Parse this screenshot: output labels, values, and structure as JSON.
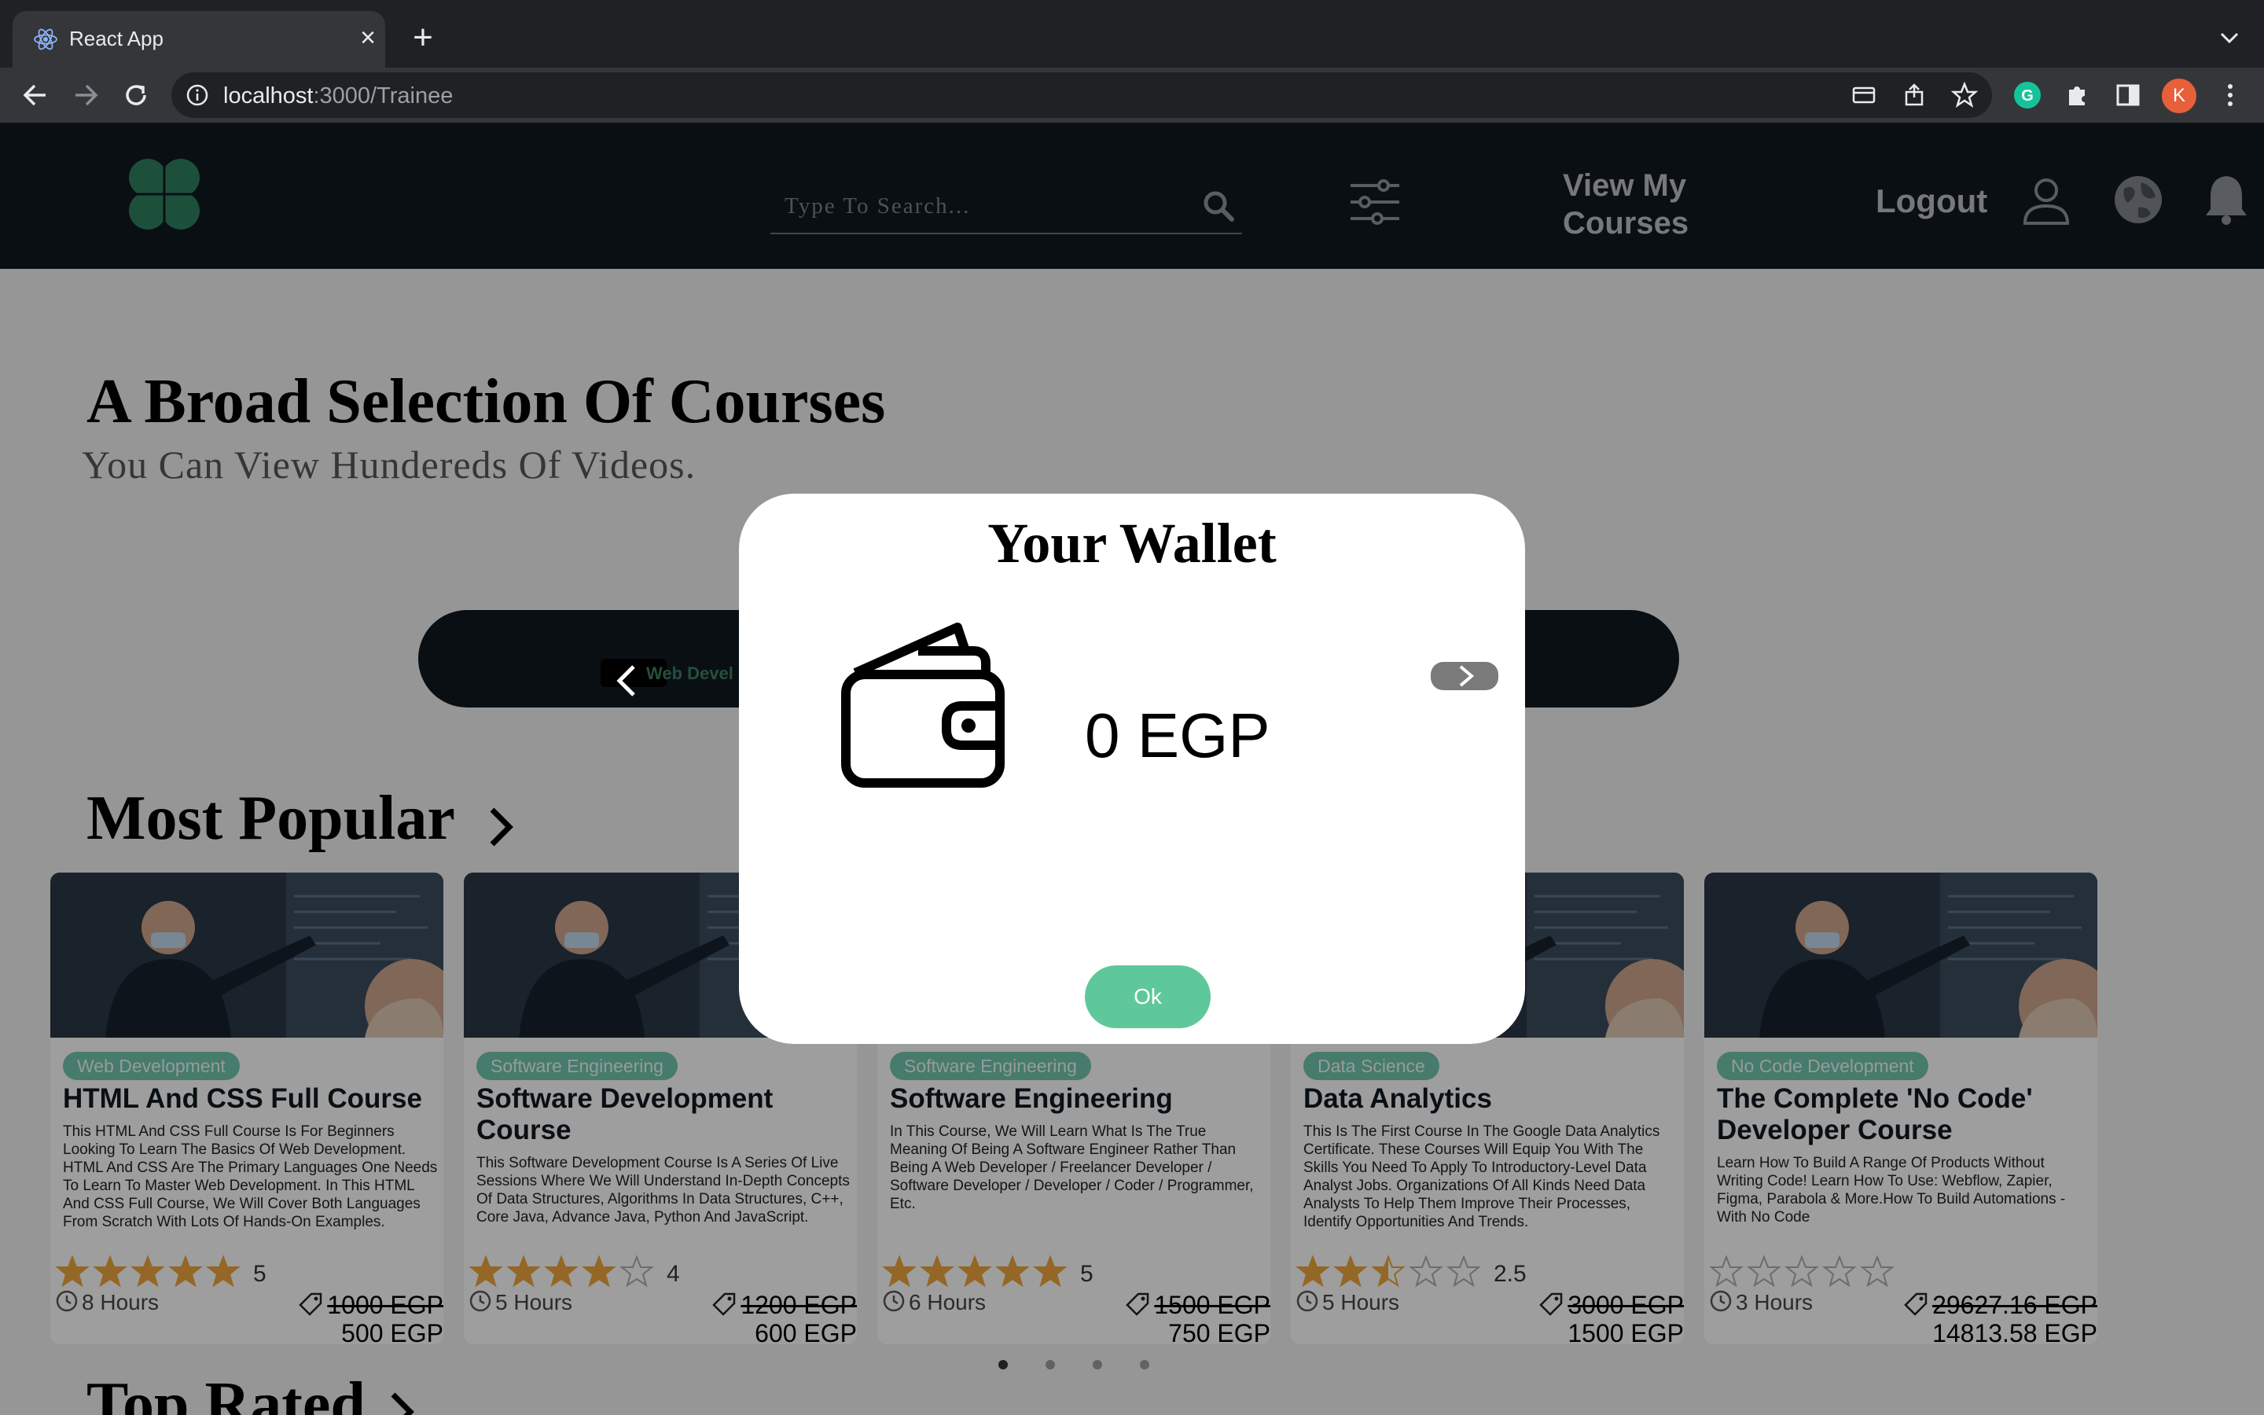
{
  "browser": {
    "tab_title": "React App",
    "url_host": "localhost",
    "url_path": ":3000/Trainee",
    "profile_initial": "K"
  },
  "header": {
    "search_placeholder": "Type To Search...",
    "view_courses": "View My Courses",
    "logout": "Logout"
  },
  "hero": {
    "title": "A Broad Selection Of Courses",
    "subtitle": "You Can View Hundereds Of Videos."
  },
  "category_bar": {
    "visible_chip": "Web Devel"
  },
  "sections": {
    "most_popular": "Most Popular",
    "top_rated": "Top Rated"
  },
  "courses": [
    {
      "category": "Web Development",
      "title": "HTML And CSS Full Course",
      "description": "This HTML And CSS Full Course Is For Beginners Looking To Learn The Basics Of Web Development. HTML And CSS Are The Primary Languages One Needs To Learn To Master Web Development. In This HTML And CSS Full Course, We Will Cover Both Languages From Scratch With Lots Of Hands-On Examples.",
      "rating": 5,
      "rating_label": "5",
      "hours": "8 Hours",
      "old_price": "1000 EGP",
      "price": "500 EGP"
    },
    {
      "category": "Software Engineering",
      "title": "Software Development Course",
      "description": "This Software Development Course Is A Series Of Live Sessions Where We Will Understand In-Depth Concepts Of Data Structures, Algorithms In Data Structures, C++, Core Java, Advance Java, Python And JavaScript.",
      "rating": 4,
      "rating_label": "4",
      "hours": "5 Hours",
      "old_price": "1200 EGP",
      "price": "600 EGP"
    },
    {
      "category": "Software Engineering",
      "title": "Software Engineering",
      "description": "In This Course, We Will Learn What Is The True Meaning Of Being A Software Engineer Rather Than Being A Web Developer / Freelancer Developer / Software Developer / Developer / Coder / Programmer, Etc.",
      "rating": 5,
      "rating_label": "5",
      "hours": "6 Hours",
      "old_price": "1500 EGP",
      "price": "750 EGP"
    },
    {
      "category": "Data Science",
      "title": "Data Analytics",
      "description": "This Is The First Course In The Google Data Analytics Certificate. These Courses Will Equip You With The Skills You Need To Apply To Introductory-Level Data Analyst Jobs. Organizations Of All Kinds Need Data Analysts To Help Them Improve Their Processes, Identify Opportunities And Trends.",
      "rating": 2.5,
      "rating_label": "2.5",
      "hours": "5 Hours",
      "old_price": "3000 EGP",
      "price": "1500 EGP"
    },
    {
      "category": "No Code Development",
      "title": "The Complete 'No Code' Developer Course",
      "description": "Learn How To Build A Range Of Products Without Writing Code! Learn How To Use: Webflow, Zapier, Figma, Parabola & More.How To Build Automations - With No Code",
      "rating": 0,
      "rating_label": "",
      "hours": "3 Hours",
      "old_price": "29627.16 EGP",
      "price": "14813.58 EGP"
    }
  ],
  "carousel": {
    "page_count": 4,
    "active_index": 0
  },
  "modal": {
    "title": "Your Wallet",
    "amount": "0 EGP",
    "ok_label": "Ok"
  },
  "colors": {
    "header_bg": "#101820",
    "brand_green": "#2e7d5b",
    "badge_green": "#6fc0a8",
    "ok_green": "#5ec89a",
    "star_gold": "#e8a13c"
  }
}
